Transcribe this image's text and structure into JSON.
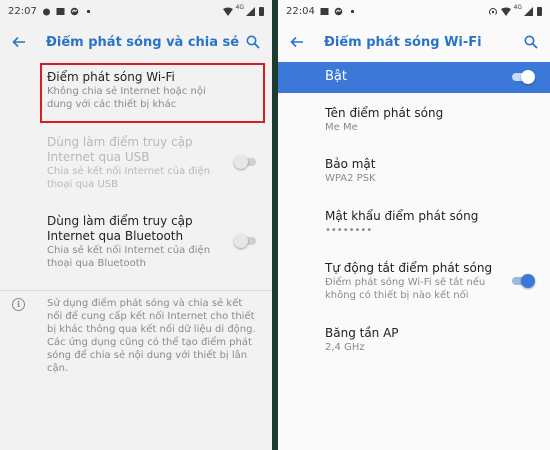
{
  "left": {
    "status": {
      "time": "22:07",
      "net_tag": "4G"
    },
    "appbar": {
      "title": "Điểm phát sóng và chia sẻ kế..."
    },
    "items": [
      {
        "title": "Điểm phát sóng Wi-Fi",
        "subtitle": "Không chia sẻ Internet hoặc nội dung với các thiết bị khác",
        "enabled": true,
        "highlighted": true
      },
      {
        "title": "Dùng làm điểm truy cập Internet qua USB",
        "subtitle": "Chia sẻ kết nối Internet của điện thoại qua USB",
        "enabled": false,
        "switch": false
      },
      {
        "title": "Dùng làm điểm truy cập Internet qua Bluetooth",
        "subtitle": "Chia sẻ kết nối Internet của điện thoại qua Bluetooth",
        "enabled": true,
        "switch": false
      }
    ],
    "info": "Sử dụng điểm phát sóng và chia sẻ kết nối để cung cấp kết nối Internet cho thiết bị khác thông qua kết nối dữ liệu di động. Các ứng dụng cũng có thể tạo điểm phát sóng để chia sẻ nội dung với thiết bị lân cận."
  },
  "right": {
    "status": {
      "time": "22:04",
      "net_tag": "4G"
    },
    "appbar": {
      "title": "Điểm phát sóng Wi-Fi"
    },
    "master": {
      "label": "Bật",
      "on": true
    },
    "items": [
      {
        "title": "Tên điểm phát sóng",
        "subtitle": "Me Me"
      },
      {
        "title": "Bảo mật",
        "subtitle": "WPA2 PSK"
      },
      {
        "title": "Mật khẩu điểm phát sóng",
        "subtitle": "••••••••"
      },
      {
        "title": "Tự động tắt điểm phát sóng",
        "subtitle": "Điểm phát sóng Wi-Fi sẽ tắt nếu không có thiết bị nào kết nối",
        "switch": true
      },
      {
        "title": "Băng tần AP",
        "subtitle": "2,4 GHz"
      }
    ]
  },
  "colors": {
    "accent": "#2a74c8",
    "switch_on": "#3c78d8",
    "highlight_border": "#d41e24",
    "divider": "#1d3b2f"
  },
  "icons": [
    "back-arrow-icon",
    "search-icon",
    "info-icon",
    "wifi-signal-icon",
    "battery-icon",
    "hotspot-icon"
  ]
}
